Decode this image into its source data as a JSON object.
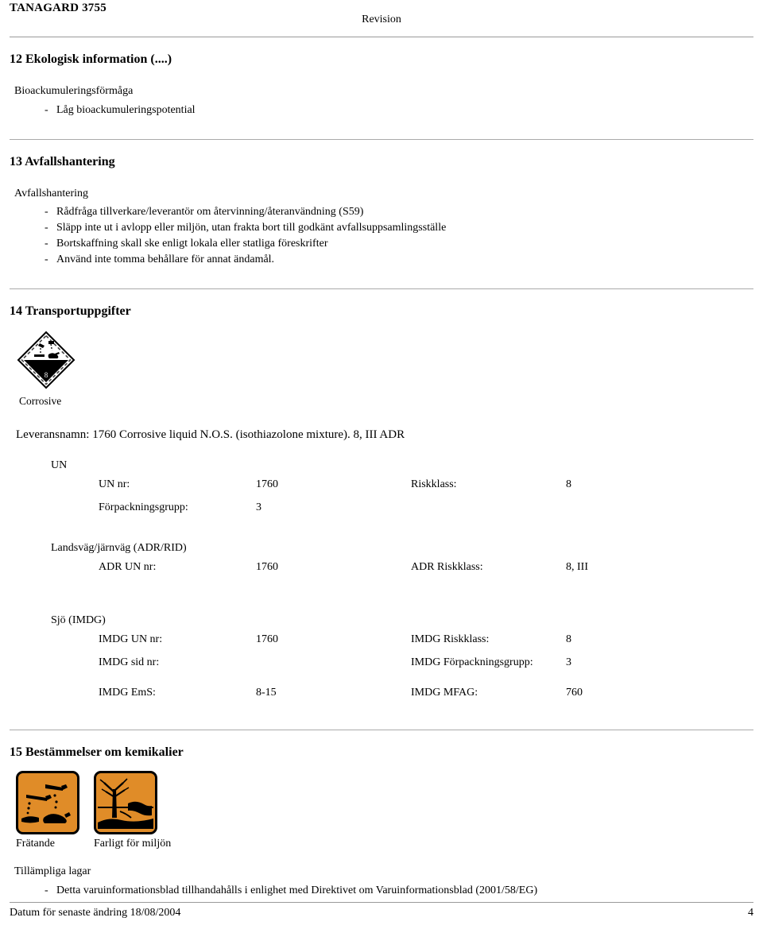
{
  "header": {
    "product": "TANAGARD 3755",
    "revision_label": "Revision"
  },
  "sections": {
    "ecological": {
      "title": "12 Ekologisk information (....)",
      "subhead": "Bioackumuleringsförmåga",
      "items": [
        "Låg bioackumuleringspotential"
      ]
    },
    "waste": {
      "title": "13 Avfallshantering",
      "subhead": "Avfallshantering",
      "items": [
        "Rådfråga tillverkare/leverantör om återvinning/återanvändning (S59)",
        "Släpp inte ut i avlopp eller miljön, utan frakta bort till godkänt avfallsuppsamlingsställe",
        "Bortskaffning skall ske enligt lokala eller statliga föreskrifter",
        "Använd inte tomma behållare för annat ändamål."
      ]
    },
    "transport": {
      "title": "14 Transportuppgifter",
      "placard_caption": "Corrosive",
      "placard_icon": "corrosive-diamond-icon",
      "placard_class_number": "8",
      "delivery_name": "Leveransnamn: 1760 Corrosive liquid N.O.S. (isothiazolone mixture). 8, III  ADR",
      "groups": [
        {
          "heading": "UN",
          "rows": [
            {
              "label": "UN nr:",
              "value": "1760",
              "label2": "Riskklass:",
              "value2": "8"
            },
            {
              "label": "Förpackningsgrupp:",
              "value": "3",
              "label2": "",
              "value2": ""
            }
          ]
        },
        {
          "heading": "Landsväg/järnväg (ADR/RID)",
          "rows": [
            {
              "label": "ADR UN nr:",
              "value": "1760",
              "label2": "ADR Riskklass:",
              "value2": "8, III"
            }
          ]
        },
        {
          "heading": "Sjö (IMDG)",
          "rows": [
            {
              "label": "IMDG UN nr:",
              "value": "1760",
              "label2": "IMDG Riskklass:",
              "value2": "8"
            },
            {
              "label": "IMDG sid nr:",
              "value": "",
              "label2": "IMDG Förpackningsgrupp:",
              "value2": "3"
            },
            {
              "label": "IMDG EmS:",
              "value": "8-15",
              "label2": "IMDG MFAG:",
              "value2": "760"
            }
          ]
        }
      ]
    },
    "regulations": {
      "title": "15 Bestämmelser om kemikalier",
      "pictograms": [
        {
          "label": "Frätande",
          "icon": "corrosive-hazard-icon"
        },
        {
          "label": "Farligt för miljön",
          "icon": "environment-hazard-icon"
        }
      ],
      "laws_subhead": "Tillämpliga lagar",
      "laws_items": [
        "Detta varuinformationsblad tillhandahålls i enlighet med Direktivet om Varuinformationsblad (2001/58/EG)"
      ]
    }
  },
  "footer": {
    "date_text": "Datum för senaste ändring 18/08/2004",
    "page_number": "4"
  },
  "colors": {
    "hazard_orange": "#e08c28",
    "rule_gray": "#9a9a9a",
    "ink": "#000000"
  }
}
